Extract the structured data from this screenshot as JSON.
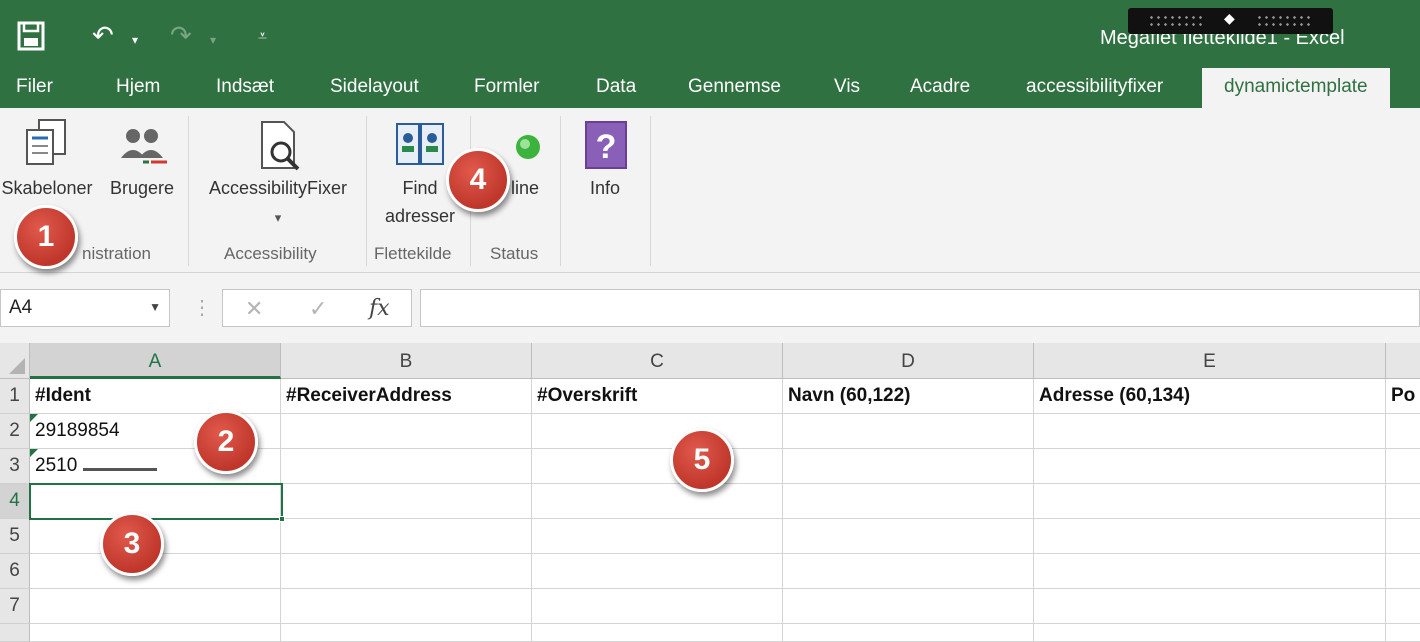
{
  "window": {
    "title": "Megafiet flettekilde1 - Excel"
  },
  "qat": {
    "save_icon": "save-icon",
    "undo_icon": "undo-icon",
    "redo_icon": "redo-icon",
    "customize_icon": "customize-qat-icon"
  },
  "tabs": [
    {
      "label": "Filer"
    },
    {
      "label": "Hjem"
    },
    {
      "label": "Indsæt"
    },
    {
      "label": "Sidelayout"
    },
    {
      "label": "Formler"
    },
    {
      "label": "Data"
    },
    {
      "label": "Gennemse"
    },
    {
      "label": "Vis"
    },
    {
      "label": "Acadre"
    },
    {
      "label": "accessibilityfixer"
    },
    {
      "label": "dynamictemplate",
      "active": true
    }
  ],
  "ribbon": {
    "groups": {
      "administration": {
        "label": "Administration",
        "label_visible": "nistration",
        "buttons": {
          "templates": "Skabeloner",
          "users": "Brugere"
        }
      },
      "accessibility": {
        "label": "Accessibility",
        "buttons": {
          "fixer": "AccessibilityFixer",
          "fixer_dropdown": "▾"
        }
      },
      "merge_source": {
        "label": "Flettekilde",
        "buttons": {
          "find_line1": "Find",
          "find_line2": "adresser"
        }
      },
      "status": {
        "label": "Status",
        "buttons": {
          "online": "Online",
          "online_visible": "line"
        }
      },
      "info": {
        "buttons": {
          "info": "Info"
        }
      }
    }
  },
  "formula_bar": {
    "name_box": "A4",
    "cancel": "✕",
    "enter": "✓",
    "fx": "fx",
    "value": ""
  },
  "sheet": {
    "columns": [
      "A",
      "B",
      "C",
      "D",
      "E"
    ],
    "rows": [
      "1",
      "2",
      "3",
      "4",
      "5",
      "6",
      "7"
    ],
    "header_row": [
      "#Ident",
      "#ReceiverAddress",
      "#Overskrift",
      "Navn (60,122)",
      "Adresse (60,134)",
      "Po"
    ],
    "data": {
      "A2": "29189854",
      "A3": "2510"
    },
    "active_cell": "A4"
  },
  "callouts": [
    "1",
    "2",
    "3",
    "4",
    "5"
  ],
  "colors": {
    "excel_green": "#2f7140",
    "callout_red": "#c0362b"
  }
}
